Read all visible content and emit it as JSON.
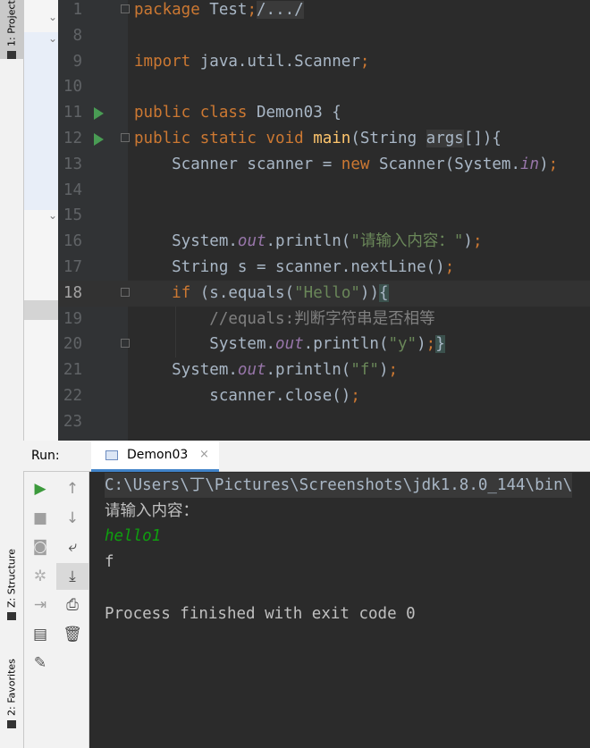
{
  "window": {
    "title": "Demon03"
  },
  "left_tabs": {
    "project": "1: Project",
    "structure": "Z: Structure",
    "favorites": "2: Favorites"
  },
  "editor": {
    "lines": [
      {
        "num": "1",
        "run": false,
        "fold": true,
        "tokens": [
          {
            "t": "package",
            "c": "kw"
          },
          {
            "t": " Test",
            "c": ""
          },
          {
            "t": ";",
            "c": "kw"
          },
          {
            "t": "/.../",
            "c": "pd"
          }
        ]
      },
      {
        "num": "8",
        "run": false,
        "fold": false,
        "tokens": []
      },
      {
        "num": "9",
        "run": false,
        "fold": false,
        "tokens": [
          {
            "t": "import",
            "c": "kw"
          },
          {
            "t": " java.util.Scanner",
            "c": ""
          },
          {
            "t": ";",
            "c": "kw"
          }
        ]
      },
      {
        "num": "10",
        "run": false,
        "fold": false,
        "tokens": []
      },
      {
        "num": "11",
        "run": true,
        "fold": false,
        "tokens": [
          {
            "t": "public class",
            "c": "kw"
          },
          {
            "t": " Demon03 {",
            "c": ""
          }
        ]
      },
      {
        "num": "12",
        "run": true,
        "fold": true,
        "tokens": [
          {
            "t": "public static void",
            "c": "kw"
          },
          {
            "t": " ",
            "c": ""
          },
          {
            "t": "main",
            "c": "fn"
          },
          {
            "t": "(String ",
            "c": ""
          },
          {
            "t": "args",
            "c": "pd"
          },
          {
            "t": "[]){",
            "c": ""
          }
        ]
      },
      {
        "num": "13",
        "run": false,
        "fold": false,
        "tokens": [
          {
            "t": "    Scanner scanner = ",
            "c": ""
          },
          {
            "t": "new",
            "c": "kw"
          },
          {
            "t": " Scanner(System.",
            "c": ""
          },
          {
            "t": "in",
            "c": "st"
          },
          {
            "t": ")",
            "c": ""
          },
          {
            "t": ";",
            "c": "kw"
          }
        ]
      },
      {
        "num": "14",
        "run": false,
        "fold": false,
        "tokens": []
      },
      {
        "num": "15",
        "run": false,
        "fold": false,
        "tokens": []
      },
      {
        "num": "16",
        "run": false,
        "fold": false,
        "tokens": [
          {
            "t": "    System.",
            "c": ""
          },
          {
            "t": "out",
            "c": "st"
          },
          {
            "t": ".println(",
            "c": ""
          },
          {
            "t": "\"请输入内容：\"",
            "c": "str"
          },
          {
            "t": ")",
            "c": ""
          },
          {
            "t": ";",
            "c": "kw"
          }
        ]
      },
      {
        "num": "17",
        "run": false,
        "fold": false,
        "tokens": [
          {
            "t": "    String s = scanner.nextLine()",
            "c": ""
          },
          {
            "t": ";",
            "c": "kw"
          }
        ]
      },
      {
        "num": "18",
        "run": false,
        "fold": true,
        "cur": true,
        "tokens": [
          {
            "t": "    ",
            "c": ""
          },
          {
            "t": "if",
            "c": "kw"
          },
          {
            "t": " (s.equals(",
            "c": ""
          },
          {
            "t": "\"Hello\"",
            "c": "str"
          },
          {
            "t": "))",
            "c": ""
          },
          {
            "t": "{",
            "c": "hl"
          }
        ]
      },
      {
        "num": "19",
        "run": false,
        "fold": false,
        "tokens": [
          {
            "t": "        //equals:判断字符串是否相等",
            "c": "cm"
          }
        ]
      },
      {
        "num": "20",
        "run": false,
        "fold": true,
        "tokens": [
          {
            "t": "        System.",
            "c": ""
          },
          {
            "t": "out",
            "c": "st"
          },
          {
            "t": ".println(",
            "c": ""
          },
          {
            "t": "\"y\"",
            "c": "str"
          },
          {
            "t": ")",
            "c": ""
          },
          {
            "t": ";",
            "c": "kw"
          },
          {
            "t": "}",
            "c": "hl"
          }
        ]
      },
      {
        "num": "21",
        "run": false,
        "fold": false,
        "tokens": [
          {
            "t": "    System.",
            "c": ""
          },
          {
            "t": "out",
            "c": "st"
          },
          {
            "t": ".println(",
            "c": ""
          },
          {
            "t": "\"f\"",
            "c": "str"
          },
          {
            "t": ")",
            "c": ""
          },
          {
            "t": ";",
            "c": "kw"
          }
        ]
      },
      {
        "num": "22",
        "run": false,
        "fold": false,
        "tokens": [
          {
            "t": "        scanner.close()",
            "c": ""
          },
          {
            "t": ";",
            "c": "kw"
          }
        ]
      },
      {
        "num": "23",
        "run": false,
        "fold": false,
        "tokens": []
      }
    ]
  },
  "run_panel": {
    "label": "Run:",
    "tab": {
      "label": "Demon03",
      "close": "×"
    },
    "tools_left": [
      {
        "name": "rerun-icon",
        "glyph": "▶",
        "color": "#3c9a3c"
      },
      {
        "name": "stop-icon",
        "glyph": "■",
        "color": "#a0a0a0"
      },
      {
        "name": "camera-icon",
        "glyph": "◙",
        "color": "#a0a0a0"
      },
      {
        "name": "debug-settings-icon",
        "glyph": "✲",
        "color": "#b0b0b0"
      },
      {
        "name": "login-icon",
        "glyph": "⇥",
        "color": "#a0a0a0"
      },
      {
        "name": "layout-icon",
        "glyph": "▤",
        "color": "#4a4a4a"
      },
      {
        "name": "pin-icon",
        "glyph": "✎",
        "color": "#555555"
      }
    ],
    "tools_right": [
      {
        "name": "up-arrow-icon",
        "glyph": "↑",
        "color": "#909090"
      },
      {
        "name": "down-arrow-icon",
        "glyph": "↓",
        "color": "#909090"
      },
      {
        "name": "soft-wrap-icon",
        "glyph": "⤶",
        "color": "#4a4a4a"
      },
      {
        "name": "scroll-to-end-icon",
        "glyph": "⤓",
        "color": "#4a4a4a",
        "on": true
      },
      {
        "name": "print-icon",
        "glyph": "⎙",
        "color": "#4a4a4a"
      },
      {
        "name": "trash-icon",
        "glyph": "🗑",
        "color": "#4a4a4a"
      }
    ]
  },
  "console": {
    "lines": [
      {
        "text": "C:\\Users\\丁\\Pictures\\Screenshots\\jdk1.8.0_144\\bin\\",
        "kind": "cmd"
      },
      {
        "text": "请输入内容：",
        "kind": "out"
      },
      {
        "text": "hello1",
        "kind": "in"
      },
      {
        "text": "f",
        "kind": "out"
      },
      {
        "text": "",
        "kind": "out"
      },
      {
        "text": "Process finished with exit code 0",
        "kind": "out"
      }
    ]
  }
}
